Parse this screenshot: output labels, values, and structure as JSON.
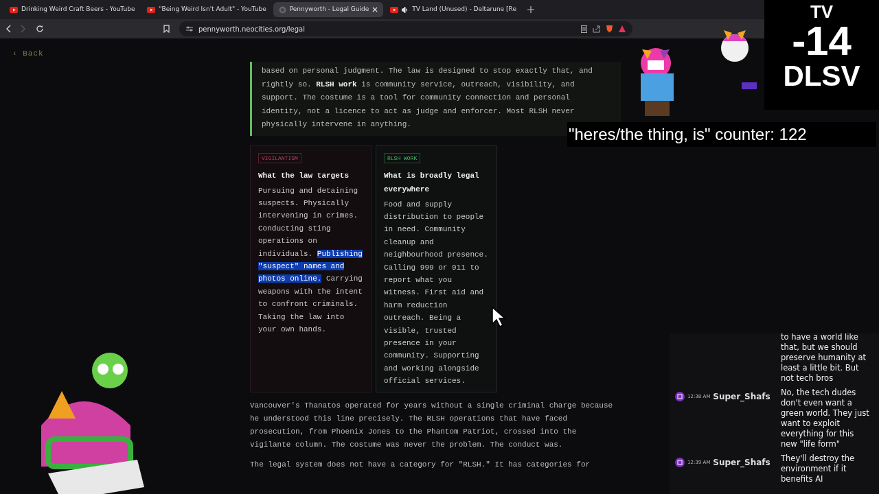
{
  "browser": {
    "tabs": [
      {
        "title": "Drinking Weird Craft Beers - YouTube",
        "kind": "youtube",
        "selected": false,
        "audio": false
      },
      {
        "title": "\"Being Weird Isn't Adult\" - YouTube",
        "kind": "youtube",
        "selected": false,
        "audio": false
      },
      {
        "title": "Pennyworth - Legal Guide",
        "kind": "site",
        "selected": true,
        "audio": false
      },
      {
        "title": "TV Land (Unused) - Deltarune [Re",
        "kind": "youtube",
        "selected": false,
        "audio": true
      }
    ],
    "forward_disabled": true,
    "url": "pennyworth.neocities.org/legal"
  },
  "page": {
    "back_link": "‹ Back",
    "quote": "based on personal judgment. The law is designed to stop exactly that, and rightly so. **RLSH work** is community service, outreach, visibility, and support. The costume is a tool for community connection and personal identity, not a licence to act as judge and enforcer. Most RLSH never physically intervene in anything.",
    "cards": [
      {
        "kind": "illegal",
        "tag": "VIGILANTISM",
        "title": "What the law targets",
        "body": [
          {
            "text": "Pursuing and detaining suspects. Physically intervening in crimes. Conducting sting operations on individuals. ",
            "selected": false
          },
          {
            "text": "Publishing \"suspect\" names and photos online.",
            "selected": true
          },
          {
            "text": " Carrying weapons with the intent to confront criminals. Taking the law into your own hands.",
            "selected": false
          }
        ]
      },
      {
        "kind": "legal",
        "tag": "RLSH WORK",
        "title": "What is broadly legal everywhere",
        "body": [
          {
            "text": "Food and supply distribution to people in need. Community cleanup and neighbourhood presence. Calling 999 or 911 to report what you witness. First aid and harm reduction outreach. Being a visible, trusted presence in your community. Supporting and working alongside official services.",
            "selected": false
          }
        ]
      }
    ],
    "paragraphs": [
      "Vancouver's Thanatos operated for years without a single criminal charge because he understood this line precisely. The RLSH operations that have faced prosecution, from Phoenix Jones to the Phantom Patriot, crossed into the vigilante column. The costume was never the problem. The conduct was.",
      "The legal system does not have a category for \"RLSH.\" It has categories for"
    ]
  },
  "overlay": {
    "rating": {
      "top": "TV",
      "age": "-14",
      "descriptors": "DLSV"
    },
    "counter": "\"heres/the thing, is\" counter: 122",
    "chat": [
      {
        "message": "to have a world like that, but we should preserve humanity at least a little bit. But not tech bros"
      },
      {
        "time": "12:38 AM",
        "user": "Super_Shafs",
        "message": "No, the tech dudes don't even want a green world. They just want to exploit everything for this new \"life form\""
      },
      {
        "time": "12:39 AM",
        "user": "Super_Shafs",
        "message": "They'll destroy the environment if it benefits AI"
      }
    ]
  }
}
